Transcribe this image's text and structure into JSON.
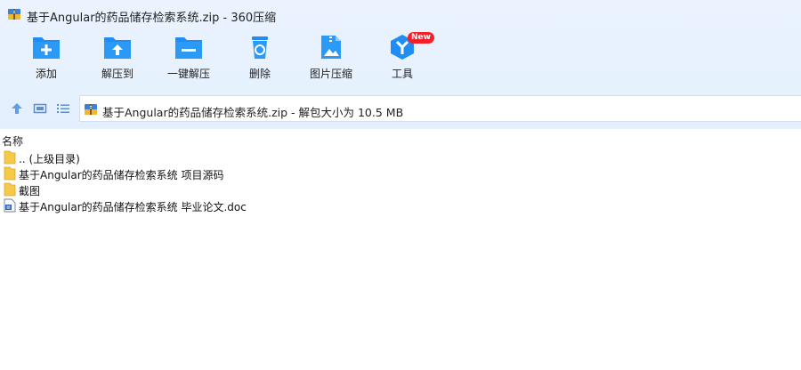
{
  "window": {
    "title": "基于Angular的药品储存检索系统.zip - 360压缩"
  },
  "toolbar": {
    "items": [
      {
        "label": "添加",
        "icon": "add-folder-icon"
      },
      {
        "label": "解压到",
        "icon": "extract-to-icon"
      },
      {
        "label": "一键解压",
        "icon": "one-click-extract-icon"
      },
      {
        "label": "删除",
        "icon": "recycle-bin-icon"
      },
      {
        "label": "图片压缩",
        "icon": "image-compress-icon"
      },
      {
        "label": "工具",
        "icon": "tools-icon",
        "badge": "New"
      }
    ]
  },
  "nav": {
    "address": "基于Angular的药品储存检索系统.zip - 解包大小为 10.5 MB"
  },
  "list": {
    "column_name": "名称",
    "items": [
      {
        "name": ".. (上级目录)",
        "type": "folder"
      },
      {
        "name": "基于Angular的药品储存检索系统 项目源码",
        "type": "folder"
      },
      {
        "name": "截图",
        "type": "folder"
      },
      {
        "name": "基于Angular的药品储存检索系统 毕业论文.doc",
        "type": "doc"
      }
    ]
  },
  "colors": {
    "accent": "#1e8ef5",
    "chrome_bg": "#e6f1fe",
    "folder": "#f7c948",
    "badge": "#f3202c"
  }
}
